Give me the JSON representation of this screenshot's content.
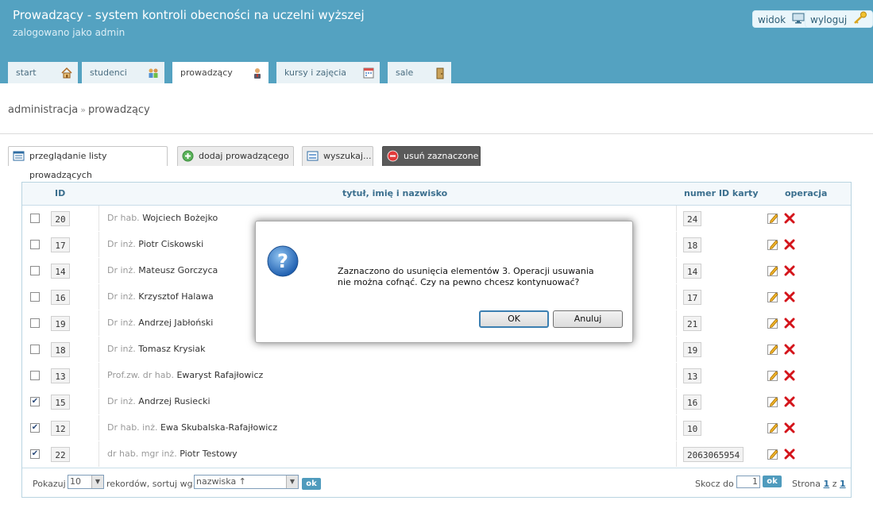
{
  "header": {
    "title": "Prowadzący - system kontroli obecności na uczelni wyższej",
    "subtitle": "zalogowano jako admin",
    "view_button": "widok",
    "logout_button": "wyloguj"
  },
  "nav": {
    "tabs": [
      {
        "label": "start",
        "icon": "home-icon"
      },
      {
        "label": "studenci",
        "icon": "students-icon"
      },
      {
        "label": "prowadzący",
        "icon": "teacher-icon",
        "active": true
      },
      {
        "label": "kursy i zajęcia",
        "icon": "calendar-icon"
      },
      {
        "label": "sale",
        "icon": "door-icon"
      }
    ]
  },
  "breadcrumb": {
    "parent": "administracja",
    "separator": "»",
    "current": "prowadzący"
  },
  "subtabs": [
    {
      "label": "przeglądanie listy prowadzących",
      "icon": "list-icon",
      "active": true
    },
    {
      "label": "dodaj prowadzącego",
      "icon": "add-icon"
    },
    {
      "label": "wyszukaj...",
      "icon": "search-form-icon"
    },
    {
      "label": "usuń zaznaczone",
      "icon": "delete-circle-icon"
    }
  ],
  "table": {
    "columns": {
      "id": "ID",
      "name": "tytuł, imię i nazwisko",
      "card": "numer ID karty",
      "operation": "operacja"
    },
    "rows": [
      {
        "checked": false,
        "id": "20",
        "title": "Dr hab.",
        "name": "Wojciech Bożejko",
        "card": "24"
      },
      {
        "checked": false,
        "id": "17",
        "title": "Dr inż.",
        "name": "Piotr Ciskowski",
        "card": "18"
      },
      {
        "checked": false,
        "id": "14",
        "title": "Dr inż.",
        "name": "Mateusz Gorczyca",
        "card": "14"
      },
      {
        "checked": false,
        "id": "16",
        "title": "Dr inż.",
        "name": "Krzysztof Halawa",
        "card": "17"
      },
      {
        "checked": false,
        "id": "19",
        "title": "Dr inż.",
        "name": "Andrzej Jabłoński",
        "card": "21"
      },
      {
        "checked": false,
        "id": "18",
        "title": "Dr inż.",
        "name": "Tomasz Krysiak",
        "card": "19"
      },
      {
        "checked": false,
        "id": "13",
        "title": "Prof.zw. dr hab.",
        "name": "Ewaryst Rafajłowicz",
        "card": "13"
      },
      {
        "checked": true,
        "id": "15",
        "title": "Dr inż.",
        "name": "Andrzej Rusiecki",
        "card": "16"
      },
      {
        "checked": true,
        "id": "12",
        "title": "Dr hab. inż.",
        "name": "Ewa Skubalska-Rafajłowicz",
        "card": "10"
      },
      {
        "checked": true,
        "id": "22",
        "title": "dr hab. mgr inż.",
        "name": "Piotr Testowy",
        "card": "2063065954"
      }
    ]
  },
  "footer": {
    "show_label": "Pokazuj",
    "page_size": "10",
    "records_label": "rekordów, sortuj wg.",
    "sort_by": "nazwiska ↑",
    "ok": "ok",
    "goto_label": "Skocz do",
    "goto_value": "1",
    "page_label": "Strona",
    "page_current": "1",
    "page_of": "z",
    "page_total": "1"
  },
  "dialog": {
    "message_line1": "Zaznaczono do usunięcia elementów 3. Operacji usuwania",
    "message_line2": "nie można cofnąć. Czy na pewno chcesz kontynuować?",
    "ok_button": "OK",
    "cancel_button": "Anuluj"
  },
  "colors": {
    "header_bg": "#54a2c1",
    "delete_tab_bg": "#5a5a5a",
    "ok_button_bg": "#4f9bbd",
    "delete_icon": "#d4141b"
  }
}
